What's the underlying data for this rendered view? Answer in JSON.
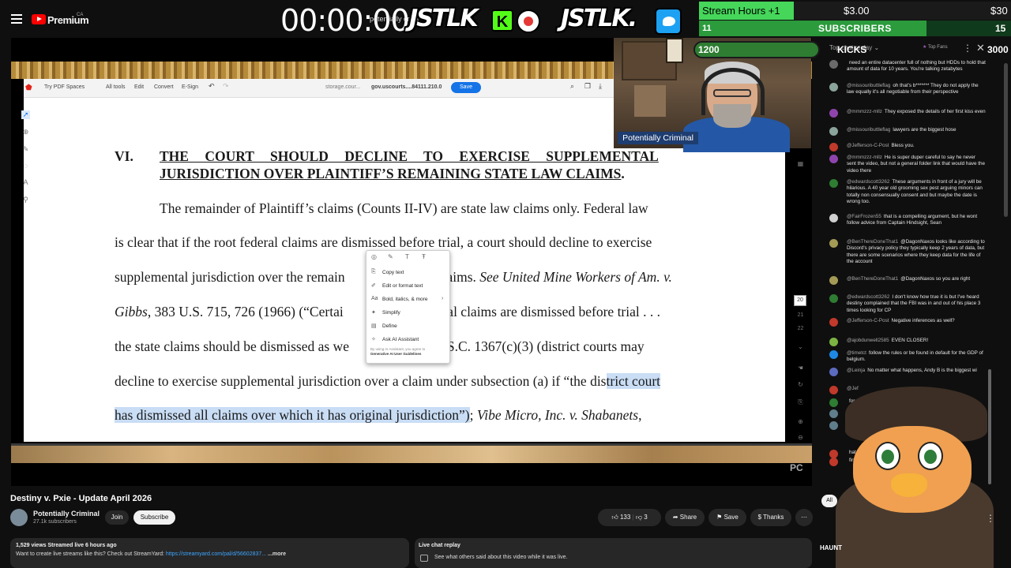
{
  "youtube": {
    "brand": "Premium",
    "country": "CA"
  },
  "overlay": {
    "timer": "00:00:00",
    "mini_title": "potentially crimi",
    "jstlk_a": "JSTLK",
    "kick_letter": "K",
    "jstlk_b": "JSTLK."
  },
  "goals": {
    "stream_hours_label": "Stream Hours +1",
    "stream_hours_value": "$3.00",
    "stream_hours_max": "$30",
    "subs_count": "11",
    "subs_label": "SUBSCRIBERS",
    "subs_max": "15",
    "kicks_count": "1200",
    "kicks_label": "KICKS",
    "kicks_max": "3000"
  },
  "pdf_toolbar": {
    "try_spaces": "Try PDF Spaces",
    "all_tools": "All tools",
    "edit": "Edit",
    "convert": "Convert",
    "esign": "E-Sign",
    "file_a": "storage.cour...",
    "file_b": "gov.uscourts....84111.210.0",
    "save": "Save",
    "page_num": "20",
    "page_a": "21",
    "page_b": "22"
  },
  "document": {
    "section_num": "VI.",
    "heading_line1": "THE COURT SHOULD DECLINE TO EXERCISE SUPPLEMENTAL",
    "heading_line2": "JURISDICTION OVER PLAINTIFF’S REMAINING STATE LAW CLAIMS",
    "heading_period": ".",
    "p1": "The remainder of Plaintiff’s claims (Counts II-IV) are state law claims only. Federal law",
    "p2": "is clear that if the root federal claims are dismissed before trial, a court should decline to exercise",
    "p3a": "supplemental jurisdiction over the remain",
    "p3b": "laims. ",
    "p3c": "See United Mine Workers of Am. v.",
    "p4a": "Gibbs",
    "p4b": ", 383 U.S. 715, 726 (1966) (“Certai",
    "p4c": "eral claims are dismissed before trial . . .",
    "p5a": "the state claims should be dismissed as we",
    "p5b": "28 U.S.C. 1367(c)(3) (district courts may",
    "p6a": "decline to exercise supplemental jurisdiction over a claim under subsection (a) if “the dis",
    "p6b": "trict court",
    "p7a": "has dismissed all claims over which it has original jurisdiction”)",
    "p7b": "; ",
    "p7c": "Vibe Micro, Inc. v. Shabanets",
    "p7d": ","
  },
  "context_menu": {
    "items": [
      "Copy text",
      "Edit or format text",
      "Bold, italics, & more",
      "Simplify",
      "Define",
      "Ask AI Assistant"
    ],
    "footer_a": "By using AI Assistant, you agree to",
    "footer_b": "Generative AI User Guidelines"
  },
  "webcam": {
    "name": "Potentially Criminal"
  },
  "chat": {
    "top_label": "Top chat replay",
    "top_fans": "Top Fans",
    "messages": [
      {
        "author": "",
        "text": "need an entire datacenter full of nothing but HDDs to hold that amount of data for 10 years. You're talking zetabytes",
        "color": "#6a6a6a"
      },
      {
        "author": "@missouributtleflag",
        "text": "oh that's b******* They do not apply the law equally it's all negotiable from their perspective",
        "color": "#8aa39b"
      },
      {
        "author": "@mmmzzz-mllz",
        "text": "They exposed the details of her first kiss even",
        "color": "#8e44ad"
      },
      {
        "author": "@missouributtleflag",
        "text": "lawyers are the biggest hose",
        "color": "#8aa39b"
      },
      {
        "author": "@Jefferson-C-Post",
        "text": "Bless you.",
        "color": "#c0392b"
      },
      {
        "author": "@mmmzzz-mllz",
        "text": "He is super duper careful to say he never sent the video, but not a general folder link that would have the video there",
        "color": "#8e44ad"
      },
      {
        "author": "@edwardscott3262",
        "text": "These arguments in front of a jury will be hilarious. A 40 year old grooming sex pest arguing minors can totally non consensually consent and but maybe the date is wrong too.",
        "color": "#2e7d32"
      },
      {
        "author": "@FairFrozen55",
        "text": "that is a compelling argument, but he wont follow advice from Captain Hindsight, Sean",
        "color": "#d0d0d0"
      },
      {
        "author": "@BenThereDoneThat1",
        "text": "@DagonNaxos looks like according to Discord's privacy policy they typically keep 2 years of data, but there are some scenarios where they keep data for the life of the account",
        "color": "#a39a56"
      },
      {
        "author": "@BenThereDoneThat1",
        "text": "@DagonNaxos so you are right",
        "color": "#a39a56"
      },
      {
        "author": "@edwardscott3262",
        "text": "I don't know how true it is but I've heard destiny complained that the FBI was in and out of his place 3 times looking for CP",
        "color": "#2e7d32"
      },
      {
        "author": "@Jefferson-C-Post",
        "text": "Negative inferences as well?",
        "color": "#c0392b"
      },
      {
        "author": "@ajobdunwell2585",
        "text": "EVEN CLOSER!",
        "color": "#7cb342"
      },
      {
        "author": "@timetct",
        "text": "follow the rules or be found in default for the GDP of belgium.",
        "color": "#1e88e5"
      },
      {
        "author": "@Leinja",
        "text": "No matter what happens, Andy B is the biggest wi",
        "color": "#5c6bc0"
      },
      {
        "author": "@Jef",
        "text": "",
        "color": "#c0392b"
      },
      {
        "author": "",
        "text": "for",
        "color": "#2e7d32"
      },
      {
        "author": "",
        "text": "",
        "color": "#607d8b"
      },
      {
        "author": "",
        "text": "",
        "color": "#607d8b"
      },
      {
        "author": "",
        "text": "hat",
        "color": "#c0392b"
      },
      {
        "author": "",
        "text": "firm?",
        "color": "#c0392b"
      }
    ]
  },
  "video": {
    "title": "Destiny v. Pxie - Update April 2026",
    "channel": "Potentially Criminal",
    "subs": "27.1k subscribers",
    "join": "Join",
    "subscribe": "Subscribe",
    "likes": "133",
    "dislikes": "3",
    "share": "Share",
    "save": "Save",
    "thanks": "Thanks",
    "views_line": "1,529 views  Streamed live 6 hours ago",
    "desc_text": "Want to create live streams like this? Check out StreamYard: ",
    "desc_link": "https://streamyard.com/pal/d/56602837...",
    "desc_more": "  ...more",
    "replay_title": "Live chat replay",
    "replay_sub": "See what others said about this video while it was live.",
    "pc_logo": "PC",
    "all_chip": "All",
    "haunt": "HAUNT"
  }
}
